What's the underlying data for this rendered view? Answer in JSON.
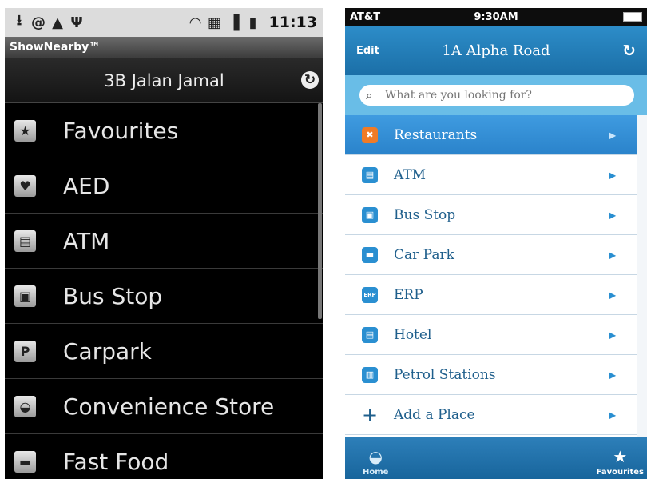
{
  "android": {
    "status_icons": [
      "download-icon",
      "at-icon",
      "warning-icon",
      "usb-icon"
    ],
    "status_right_icons": [
      "wifi-icon",
      "3g-icon",
      "signal-icon",
      "battery-icon"
    ],
    "status_time": "11:13",
    "app_name": "ShowNearby™",
    "location": "3B Jalan Jamal",
    "items": [
      {
        "label": "Favourites",
        "icon": "star-icon",
        "glyph": "★"
      },
      {
        "label": "AED",
        "icon": "heart-icon",
        "glyph": "♥"
      },
      {
        "label": "ATM",
        "icon": "atm-icon",
        "glyph": "▤"
      },
      {
        "label": "Bus Stop",
        "icon": "bus-icon",
        "glyph": "▣"
      },
      {
        "label": "Carpark",
        "icon": "parking-icon",
        "glyph": "P"
      },
      {
        "label": "Convenience Store",
        "icon": "store-icon",
        "glyph": "◒"
      },
      {
        "label": "Fast Food",
        "icon": "fastfood-icon",
        "glyph": "▬"
      }
    ]
  },
  "iphone": {
    "carrier": "AT&T",
    "status_time": "9:30AM",
    "nav": {
      "edit": "Edit",
      "title": "1A Alpha Road",
      "reload": "↻"
    },
    "search_placeholder": "What are you looking for?",
    "items": [
      {
        "label": "Restaurants",
        "icon": "restaurant-icon",
        "glyph": "✖"
      },
      {
        "label": "ATM",
        "icon": "atm-icon",
        "glyph": "▤"
      },
      {
        "label": "Bus Stop",
        "icon": "bus-icon",
        "glyph": "▣"
      },
      {
        "label": "Car Park",
        "icon": "car-icon",
        "glyph": "▬"
      },
      {
        "label": "ERP",
        "icon": "erp-icon",
        "glyph": "ERP"
      },
      {
        "label": "Hotel",
        "icon": "hotel-icon",
        "glyph": "▤"
      },
      {
        "label": "Petrol Stations",
        "icon": "petrol-icon",
        "glyph": "▥"
      },
      {
        "label": "Add a Place",
        "icon": "plus-icon",
        "glyph": "+"
      }
    ],
    "tabs": {
      "home": "Home",
      "favourites": "Favourites"
    },
    "colors": {
      "selected_row": "#2a83cb",
      "selected_icon": "#f07b26",
      "nav_bar": "#1b6fa7"
    }
  }
}
